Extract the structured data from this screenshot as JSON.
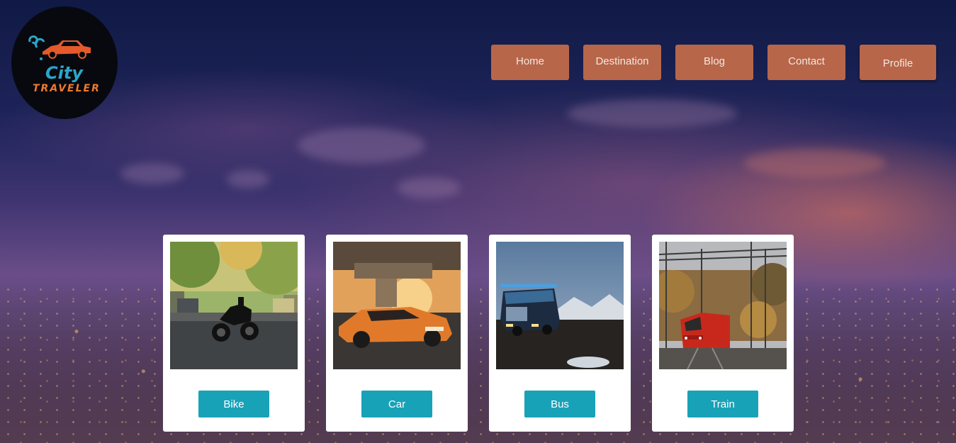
{
  "logo": {
    "line1": "City",
    "line2": "TRAVELER",
    "icon": "car-logo-icon"
  },
  "nav": {
    "items": [
      {
        "label": "Home"
      },
      {
        "label": "Destination"
      },
      {
        "label": "Blog"
      },
      {
        "label": "Contact"
      },
      {
        "label": "Profile"
      }
    ]
  },
  "cards": [
    {
      "label": "Bike",
      "image": "motorcycle-photo"
    },
    {
      "label": "Car",
      "image": "orange-car-photo"
    },
    {
      "label": "Bus",
      "image": "bus-photo"
    },
    {
      "label": "Train",
      "image": "red-train-photo"
    }
  ],
  "colors": {
    "nav_button": "#b7664a",
    "card_button": "#18a2b8",
    "logo_city": "#2ba6c9",
    "logo_traveler": "#f07a2c"
  }
}
